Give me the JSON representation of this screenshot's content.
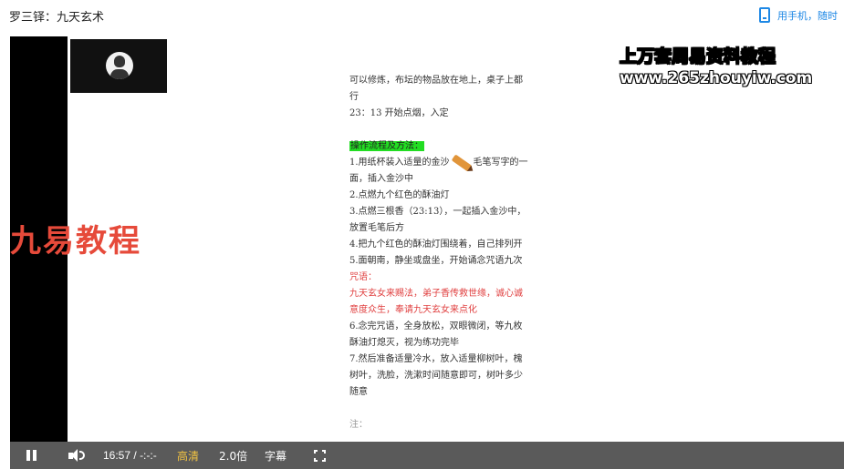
{
  "page": {
    "title": "罗三铎：九天玄术"
  },
  "header": {
    "mobile_link": "用手机，随时"
  },
  "video": {
    "watermark_left": "九易教程",
    "watermark_title": "上万套周易资料教程",
    "watermark_url": "www.265zhouyiw.com",
    "document": {
      "lines": [
        "可以修炼，布坛的物品放在地上，桌子上都",
        "行",
        "23：13 开始点烟，入定"
      ],
      "section_heading": "操作流程及方法：",
      "steps_before": "1.用纸杯装入适量的金沙",
      "steps_after": "毛笔写字的一",
      "steps": [
        "面，插入金沙中",
        "2.点燃九个红色的酥油灯",
        "3.点燃三根香（23:13），一起插入金沙中，",
        "放置毛笔后方",
        "4.把九个红色的酥油灯围绕着，自己排列开",
        "5.面朝南，静坐或盘坐，开始诵念咒语九次"
      ],
      "mantra_label": "咒语：",
      "mantra_lines": [
        "九天玄女来赐法，弟子香传救世缘，诚心诚",
        "意度众生，奉请九天玄女来点化"
      ],
      "steps_more": [
        "6.念完咒语，全身放松，双眼微闭，等九枚",
        "酥油灯熄灭，视为练功完毕",
        "7.然后准备适量冷水，放入适量柳树叶，槐",
        "树叶，洗脸，洗漱时间随意即可，树叶多少",
        "随意"
      ],
      "note": "注："
    }
  },
  "controls": {
    "time_current": "16:57",
    "time_separator": "/",
    "time_total": "-:-:-",
    "quality": "高清",
    "speed": "2.0倍",
    "subtitle": "字幕"
  }
}
